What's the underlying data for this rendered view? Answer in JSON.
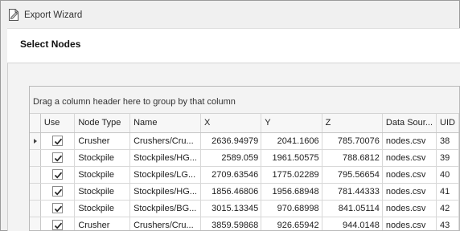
{
  "window": {
    "title": "Export Wizard",
    "icon": "export-document-icon"
  },
  "header": {
    "title": "Select Nodes"
  },
  "grid": {
    "group_panel_text": "Drag a column header here to group by that column",
    "columns": [
      "Use",
      "Node Type",
      "Name",
      "X",
      "Y",
      "Z",
      "Data Sour...",
      "UID"
    ],
    "rows": [
      {
        "use": true,
        "node_type": "Crusher",
        "name": "Crushers/Cru...",
        "x": "2636.94979",
        "y": "2041.1606",
        "z": "785.70076",
        "data_source": "nodes.csv",
        "uid": "38"
      },
      {
        "use": true,
        "node_type": "Stockpile",
        "name": "Stockpiles/HG...",
        "x": "2589.059",
        "y": "1961.50575",
        "z": "788.6812",
        "data_source": "nodes.csv",
        "uid": "39"
      },
      {
        "use": true,
        "node_type": "Stockpile",
        "name": "Stockpiles/LG...",
        "x": "2709.63546",
        "y": "1775.02289",
        "z": "795.56654",
        "data_source": "nodes.csv",
        "uid": "40"
      },
      {
        "use": true,
        "node_type": "Stockpile",
        "name": "Stockpiles/HG...",
        "x": "1856.46806",
        "y": "1956.68948",
        "z": "781.44333",
        "data_source": "nodes.csv",
        "uid": "41"
      },
      {
        "use": true,
        "node_type": "Stockpile",
        "name": "Stockpiles/BG...",
        "x": "3015.13345",
        "y": "970.68998",
        "z": "841.05114",
        "data_source": "nodes.csv",
        "uid": "42"
      },
      {
        "use": true,
        "node_type": "Crusher",
        "name": "Crushers/Cru...",
        "x": "3859.59868",
        "y": "926.65942",
        "z": "944.0148",
        "data_source": "nodes.csv",
        "uid": "43"
      }
    ],
    "focused_row_indicator": "row-indicator-arrow-icon"
  },
  "colors": {
    "header_bg": "#ffffff",
    "window_bg": "#f0f0f0",
    "grid_border": "#b9b9b9"
  }
}
